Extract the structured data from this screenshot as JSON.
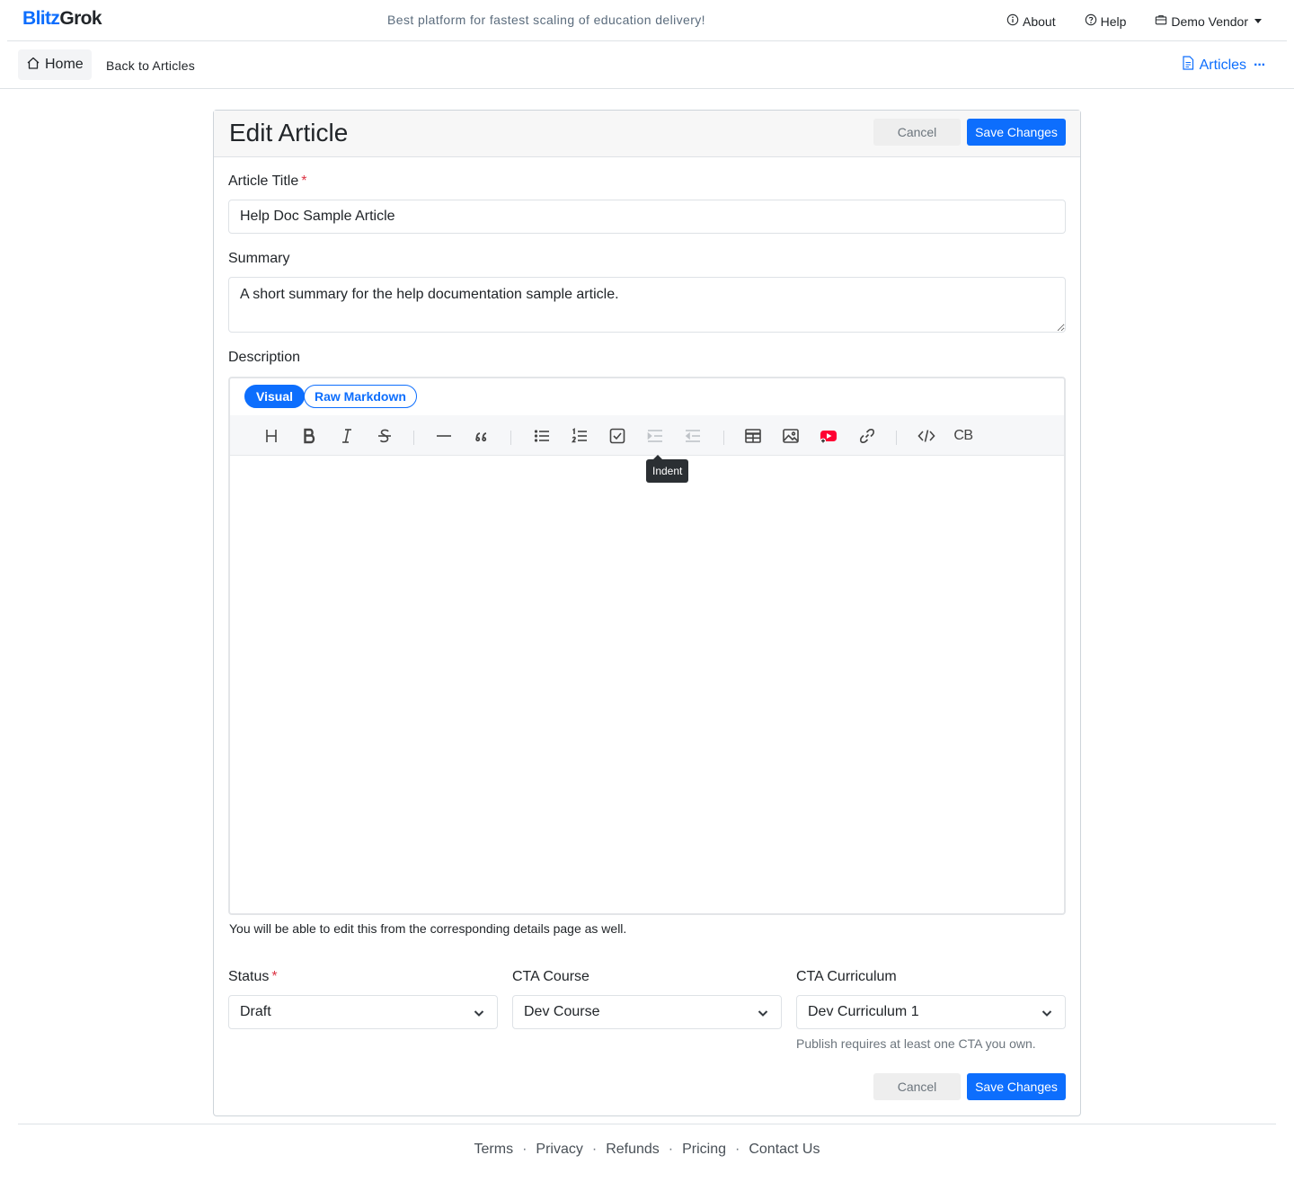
{
  "brand": {
    "part1": "Blitz",
    "part2": "Grok",
    "color": "#0d6efd"
  },
  "topbar": {
    "tagline": "Best platform for fastest scaling of education delivery!",
    "about": "About",
    "help": "Help",
    "vendor": "Demo Vendor"
  },
  "subnav": {
    "home": "Home",
    "back": "Back to Articles",
    "articles": "Articles"
  },
  "form": {
    "heading": "Edit Article",
    "cancel": "Cancel",
    "save": "Save Changes",
    "title_label": "Article Title",
    "title_value": "Help Doc Sample Article",
    "summary_label": "Summary",
    "summary_value": "A short summary for the help documentation sample article.",
    "description_label": "Description",
    "description_help": "You will be able to edit this from the corresponding details page as well.",
    "status_label": "Status",
    "status_value": "Draft",
    "cta_course_label": "CTA Course",
    "cta_course_value": "Dev Course",
    "cta_curriculum_label": "CTA Curriculum",
    "cta_curriculum_value": "Dev Curriculum 1",
    "publish_note": "Publish requires at least one CTA you own."
  },
  "editor": {
    "tab_visual": "Visual",
    "tab_raw": "Raw Markdown",
    "tooltip": "Indent",
    "toolbar_icons": [
      "heading-icon",
      "bold-icon",
      "italic-icon",
      "strikethrough-icon",
      "horizontal-rule-icon",
      "quote-icon",
      "bullet-list-icon",
      "ordered-list-icon",
      "task-list-icon",
      "indent-icon",
      "outdent-icon",
      "table-icon",
      "image-icon",
      "youtube-icon",
      "link-icon",
      "code-icon",
      "code-block-icon"
    ],
    "code_block_label": "CB"
  },
  "footer": {
    "links": [
      "Terms",
      "Privacy",
      "Refunds",
      "Pricing",
      "Contact Us"
    ]
  }
}
